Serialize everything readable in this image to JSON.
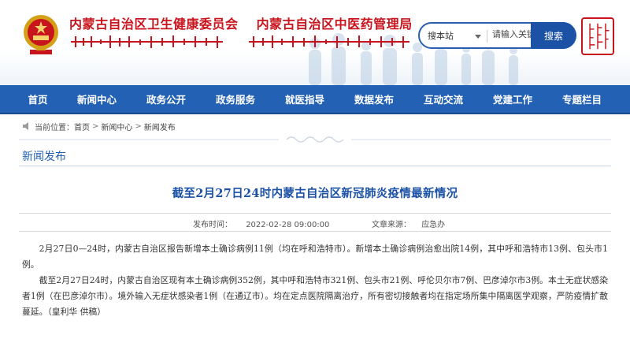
{
  "header": {
    "org_primary": "内蒙古自治区卫生健康委员会",
    "org_secondary": "内蒙古自治区中医药管理局",
    "emblem_icon": "national-emblem-icon",
    "seal_icon": "mongolian-seal-icon"
  },
  "search": {
    "scope_label": "搜本站",
    "placeholder": "请输入关键字",
    "button_label": "搜索"
  },
  "nav": {
    "items": [
      {
        "label": "首页"
      },
      {
        "label": "新闻中心"
      },
      {
        "label": "政务公开"
      },
      {
        "label": "政务服务"
      },
      {
        "label": "就医指导"
      },
      {
        "label": "数据发布"
      },
      {
        "label": "互动交流"
      },
      {
        "label": "党建工作"
      },
      {
        "label": "专题栏目"
      }
    ]
  },
  "breadcrumb": {
    "prefix": "当前位置：",
    "items": [
      "首页",
      "新闻中心",
      "新闻发布"
    ],
    "separator": ">"
  },
  "section": {
    "title": "新闻发布"
  },
  "article": {
    "title": "截至2月27日24时内蒙古自治区新冠肺炎疫情最新情况",
    "publish_label": "发布时间：",
    "publish_time": "2022-02-28 09:00:00",
    "source_label": "文章来源：",
    "source": "应急办",
    "paragraphs": [
      "2月27日0—24时，内蒙古自治区报告新增本土确诊病例11例（均在呼和浩特市）。新增本土确诊病例治愈出院14例，其中呼和浩特市13例、包头市1例。",
      "截至2月27日24时，内蒙古自治区现有本土确诊病例352例，其中呼和浩特市321例、包头市21例、呼伦贝尔市7例、巴彦淖尔市3例。本土无症状感染者1例（在巴彦淖尔市）。境外输入无症状感染者1例（在通辽市）。均在定点医院隔离治疗，所有密切接触者均在指定场所集中隔离医学观察，严防疫情扩散蔓延。（皇利华 供稿）"
    ]
  },
  "colors": {
    "nav_bg": "#2361b4",
    "brand_red": "#c8141c",
    "link_blue": "#1c52a6"
  }
}
